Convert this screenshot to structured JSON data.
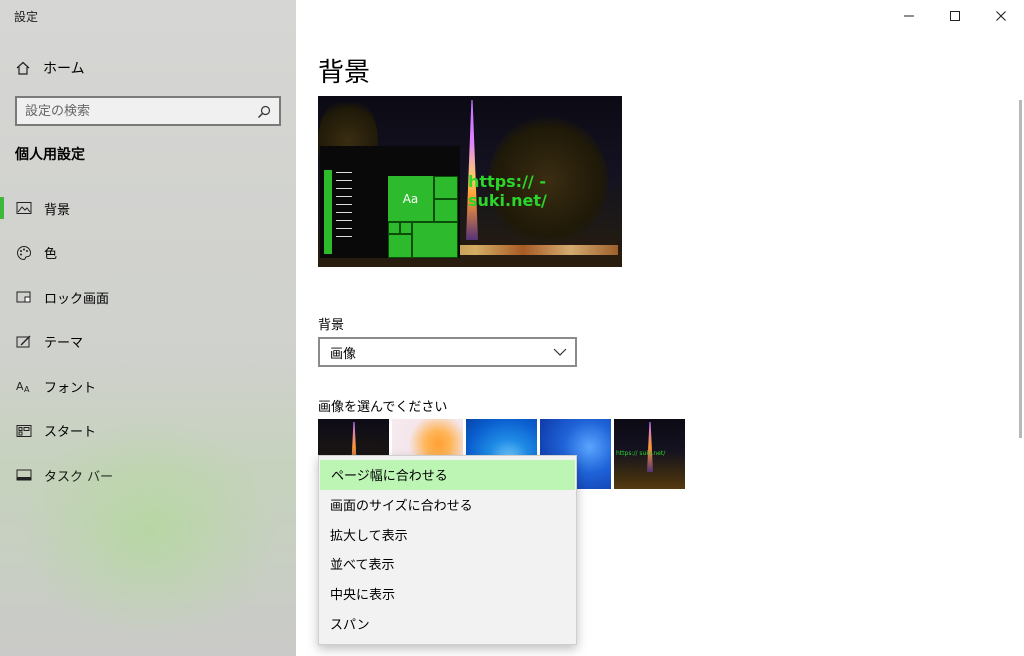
{
  "app": {
    "title": "設定"
  },
  "window": {
    "buttons": [
      "minimize",
      "maximize",
      "close"
    ]
  },
  "sidebar": {
    "home_label": "ホーム",
    "search_placeholder": "設定の検索",
    "section_title": "個人用設定",
    "items": [
      {
        "label": "背景",
        "icon": "image-icon",
        "active": true
      },
      {
        "label": "色",
        "icon": "palette-icon",
        "active": false
      },
      {
        "label": "ロック画面",
        "icon": "lock-screen-icon",
        "active": false
      },
      {
        "label": "テーマ",
        "icon": "theme-icon",
        "active": false
      },
      {
        "label": "フォント",
        "icon": "font-icon",
        "active": false
      },
      {
        "label": "スタート",
        "icon": "start-icon",
        "active": false
      },
      {
        "label": "タスク バー",
        "icon": "taskbar-icon",
        "active": false
      }
    ],
    "accent_color": "#3db83b"
  },
  "main": {
    "title": "背景",
    "preview": {
      "url_text": "https://   -suki.net/",
      "tile_label": "Aa"
    },
    "background_label": "背景",
    "background_value": "画像",
    "choose_image_label": "画像を選んでください",
    "thumbnail_caption": "https://   suki.net/",
    "fit_options": [
      "ページ幅に合わせる",
      "画面のサイズに合わせる",
      "拡大して表示",
      "並べて表示",
      "中央に表示",
      "スパン"
    ],
    "selected_fit_index": 0,
    "selection_color": "#bdf5b5"
  }
}
